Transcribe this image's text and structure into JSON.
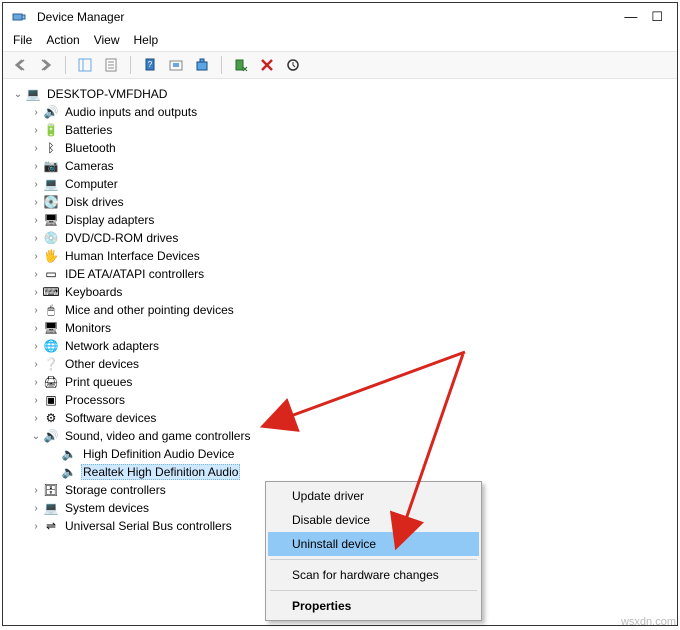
{
  "window": {
    "title": "Device Manager",
    "controls": {
      "minimize": "—",
      "maximize": "☐"
    }
  },
  "menubar": [
    "File",
    "Action",
    "View",
    "Help"
  ],
  "tree": {
    "root": "DESKTOP-VMFDHAD",
    "categories": [
      {
        "label": "Audio inputs and outputs",
        "expanded": false
      },
      {
        "label": "Batteries",
        "expanded": false
      },
      {
        "label": "Bluetooth",
        "expanded": false
      },
      {
        "label": "Cameras",
        "expanded": false
      },
      {
        "label": "Computer",
        "expanded": false
      },
      {
        "label": "Disk drives",
        "expanded": false
      },
      {
        "label": "Display adapters",
        "expanded": false
      },
      {
        "label": "DVD/CD-ROM drives",
        "expanded": false
      },
      {
        "label": "Human Interface Devices",
        "expanded": false
      },
      {
        "label": "IDE ATA/ATAPI controllers",
        "expanded": false
      },
      {
        "label": "Keyboards",
        "expanded": false
      },
      {
        "label": "Mice and other pointing devices",
        "expanded": false
      },
      {
        "label": "Monitors",
        "expanded": false
      },
      {
        "label": "Network adapters",
        "expanded": false
      },
      {
        "label": "Other devices",
        "expanded": false
      },
      {
        "label": "Print queues",
        "expanded": false
      },
      {
        "label": "Processors",
        "expanded": false
      },
      {
        "label": "Software devices",
        "expanded": false
      },
      {
        "label": "Sound, video and game controllers",
        "expanded": true,
        "children": [
          {
            "label": "High Definition Audio Device",
            "selected": false
          },
          {
            "label": "Realtek High Definition Audio",
            "selected": true
          }
        ]
      },
      {
        "label": "Storage controllers",
        "expanded": false
      },
      {
        "label": "System devices",
        "expanded": false
      },
      {
        "label": "Universal Serial Bus controllers",
        "expanded": false
      }
    ]
  },
  "context_menu": {
    "items": [
      {
        "label": "Update driver",
        "highlight": false
      },
      {
        "label": "Disable device",
        "highlight": false
      },
      {
        "label": "Uninstall device",
        "highlight": true
      },
      {
        "sep": true
      },
      {
        "label": "Scan for hardware changes",
        "highlight": false
      },
      {
        "sep": true
      },
      {
        "label": "Properties",
        "bold": true,
        "highlight": false
      }
    ]
  },
  "watermark": "wsxdn.com",
  "icons": {
    "audio": "🔊",
    "battery": "🔋",
    "bluetooth": "ᛒ",
    "camera": "📷",
    "computer": "💻",
    "disk": "💽",
    "display": "🖥",
    "dvd": "💿",
    "hid": "🖐",
    "ide": "▭",
    "keyboard": "⌨",
    "mouse": "🖱",
    "monitor": "🖥",
    "network": "🌐",
    "other": "❔",
    "printer": "🖨",
    "cpu": "▣",
    "software": "⚙",
    "sound": "🔊",
    "storage": "🗄",
    "system": "💻",
    "usb": "⇌",
    "root": "💻",
    "speaker": "🔈"
  }
}
